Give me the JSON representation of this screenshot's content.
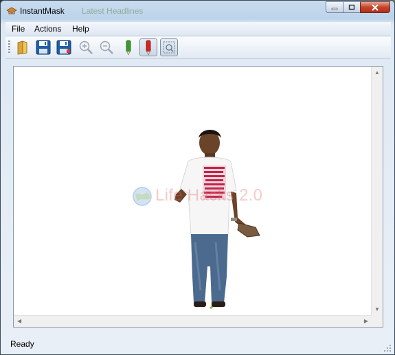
{
  "window": {
    "title": "InstantMask",
    "background_text": "Latest Headlines"
  },
  "menu": [
    {
      "label": "File"
    },
    {
      "label": "Actions"
    },
    {
      "label": "Help"
    }
  ],
  "toolbar": {
    "buttons": [
      {
        "name": "open-folder-icon",
        "pressed": false
      },
      {
        "name": "save-icon",
        "pressed": false
      },
      {
        "name": "save-as-icon",
        "pressed": false
      },
      {
        "name": "zoom-in-icon",
        "pressed": false
      },
      {
        "name": "zoom-out-icon",
        "pressed": false
      },
      {
        "name": "green-marker-icon",
        "pressed": false
      },
      {
        "name": "red-marker-icon",
        "pressed": true
      },
      {
        "name": "select-region-icon",
        "pressed": true
      }
    ]
  },
  "canvas": {
    "watermark": "Life Hacks 2.0"
  },
  "status": {
    "text": "Ready"
  },
  "colors": {
    "accent_red": "#c6442a",
    "marker_green": "#3b9a2a",
    "marker_red": "#d6231b",
    "save_blue": "#1e5fa8"
  }
}
